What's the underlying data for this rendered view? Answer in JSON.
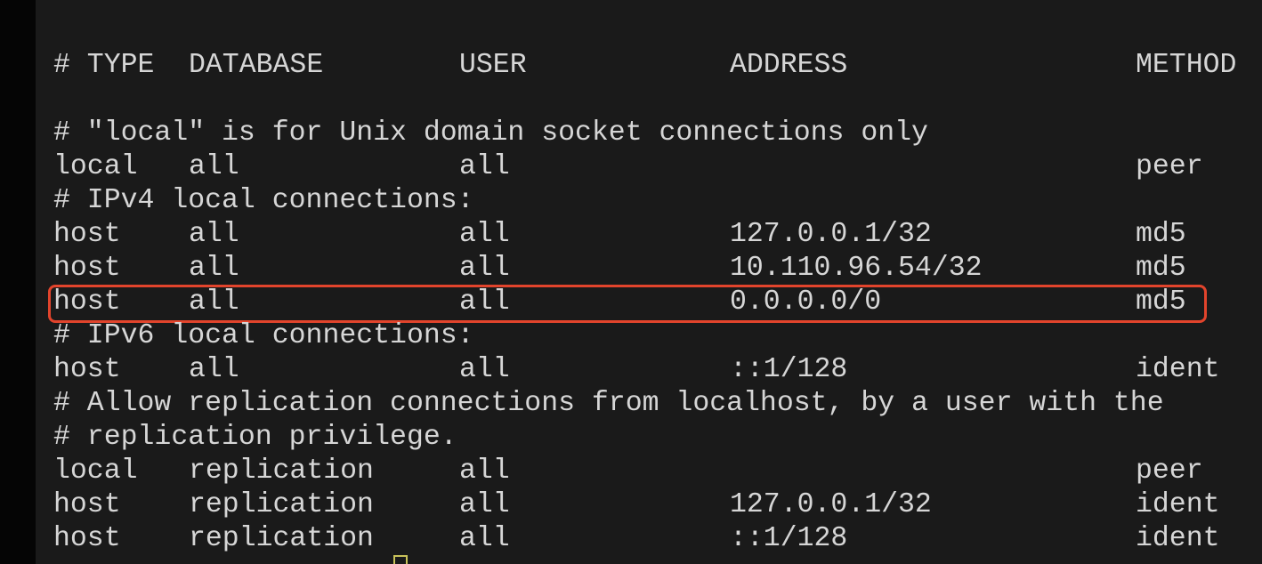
{
  "header": {
    "type": "# TYPE",
    "database": "DATABASE",
    "user": "USER",
    "address": "ADDRESS",
    "method": "METHOD"
  },
  "comments": {
    "local_unix": "# \"local\" is for Unix domain socket connections only",
    "ipv4": "# IPv4 local connections:",
    "ipv6": "# IPv6 local connections:",
    "replication_1": "# Allow replication connections from localhost, by a user with the",
    "replication_2": "# replication privilege."
  },
  "rows": [
    {
      "type": "local",
      "database": "all",
      "user": "all",
      "address": "",
      "method": "peer"
    },
    {
      "type": "host",
      "database": "all",
      "user": "all",
      "address": "127.0.0.1/32",
      "method": "md5"
    },
    {
      "type": "host",
      "database": "all",
      "user": "all",
      "address": "10.110.96.54/32",
      "method": "md5"
    },
    {
      "type": "host",
      "database": "all",
      "user": "all",
      "address": "0.0.0.0/0",
      "method": "md5"
    },
    {
      "type": "host",
      "database": "all",
      "user": "all",
      "address": "::1/128",
      "method": "ident"
    },
    {
      "type": "local",
      "database": "replication",
      "user": "all",
      "address": "",
      "method": "peer"
    },
    {
      "type": "host",
      "database": "replication",
      "user": "all",
      "address": "127.0.0.1/32",
      "method": "ident"
    },
    {
      "type": "host",
      "database": "replication",
      "user": "all",
      "address": "::1/128",
      "method": "ident"
    }
  ],
  "colors": {
    "terminal_bg": "#1a1a1a",
    "text": "#d6d6d6",
    "highlight_border": "#e2442c",
    "cursor": "#c9c25a"
  },
  "highlighted_row": 3
}
